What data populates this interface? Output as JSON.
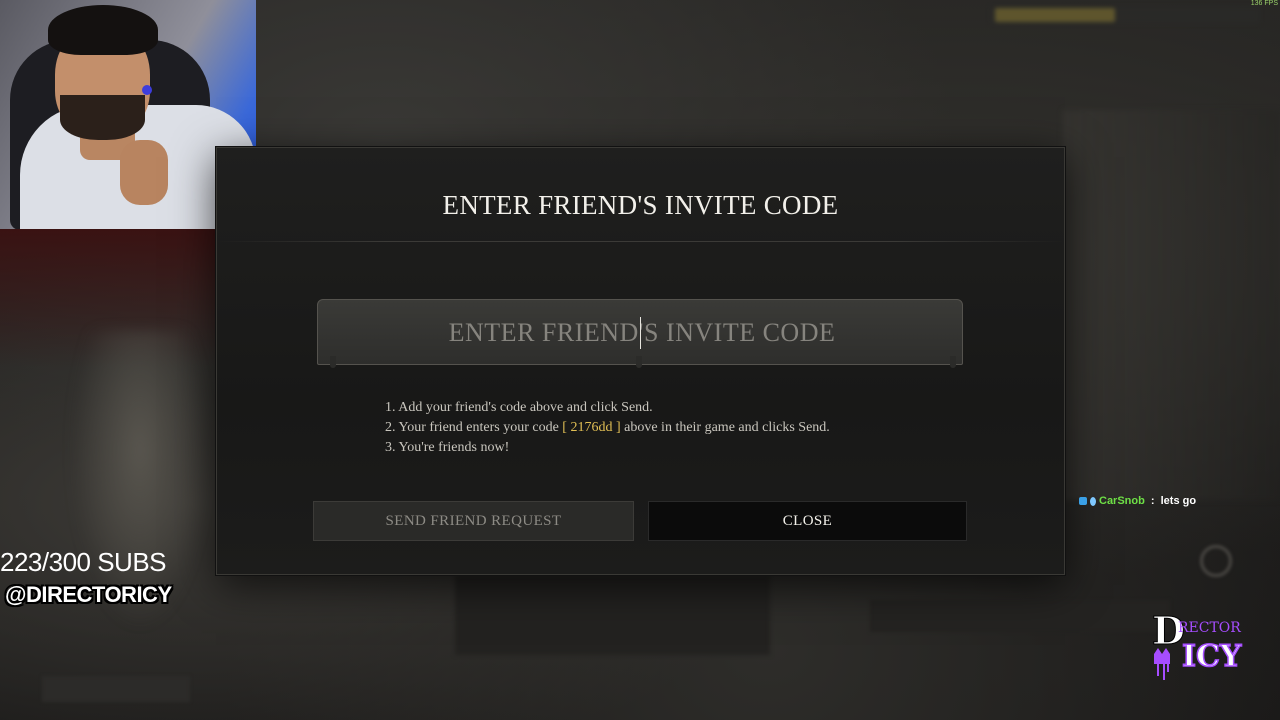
{
  "overlay": {
    "fps": "136 FPS",
    "subs": "223/300 SUBS",
    "handle": "@DIRECTORICY",
    "chat": {
      "user": "CarSnob",
      "separator": " : ",
      "message": "lets go"
    },
    "logo": {
      "line1": "D",
      "line2": "RECTOR",
      "line3": "ICY"
    }
  },
  "modal": {
    "title": "ENTER FRIEND'S INVITE CODE",
    "input": {
      "placeholder": "ENTER FRIEND'S INVITE CODE",
      "value": ""
    },
    "instructions": {
      "step1": "1. Add your friend's code above and click Send.",
      "step2_before": "2. Your friend enters your code",
      "my_code": "[ 2176dd ]",
      "step2_after": "above in their game and clicks Send.",
      "step3": "3. You're friends now!"
    },
    "buttons": {
      "send": "SEND FRIEND REQUEST",
      "close": "CLOSE"
    }
  },
  "colors": {
    "code_highlight": "#e1bf55",
    "chat_user": "#6ee046",
    "logo_purple": "#a64dff"
  }
}
